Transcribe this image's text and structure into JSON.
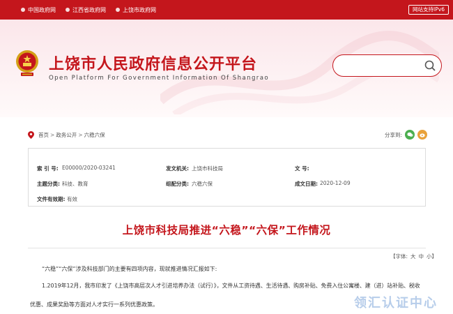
{
  "topbar": {
    "links": [
      "中国政府网",
      "江西省政府网",
      "上饶市政府网"
    ],
    "ipv6_badge": "网站支持IPv6"
  },
  "site": {
    "title": "上饶市人民政府信息公开平台",
    "subtitle": "Open Platform For Government Information Of Shangrao",
    "search_placeholder": ""
  },
  "breadcrumb": {
    "items": [
      "首页",
      "政务公开",
      "六稳六保"
    ],
    "separator": ">"
  },
  "share": {
    "label": "分享到:"
  },
  "meta": {
    "index_label": "索 引 号:",
    "index_value": "E00000/2020-03241",
    "org_label": "发文机关:",
    "org_value": "上饶市科技局",
    "docno_label": "文      号:",
    "docno_value": "",
    "topic_label": "主题分类:",
    "topic_value": "科技、教育",
    "theme_label": "组配分类:",
    "theme_value": "六稳六保",
    "date_label": "成文日期:",
    "date_value": "2020-12-09",
    "validity_label": "文件有效期:",
    "validity_value": "有效"
  },
  "article": {
    "title": "上饶市科技局推进“六稳”“六保”工作情况",
    "fontsize_label": "【字体:",
    "fontsize_options": [
      "大",
      "中",
      "小】"
    ],
    "paragraphs": [
      "“六稳”“六保”涉及科技部门的主要有四项内容，现就推进情况汇报如下:",
      "1.2019年12月，我市印发了《上饶市高层次人才引进培养办法（试行）》，文件从工资待遇、生活待遇、购房补贴、免费入住公寓楼、建（进）站补贴、税收",
      "优惠、成果奖励等方面对人才实行一系列优惠政策。"
    ]
  },
  "watermark": "领汇认证中心",
  "colors": {
    "brand_red": "#c4161c"
  }
}
